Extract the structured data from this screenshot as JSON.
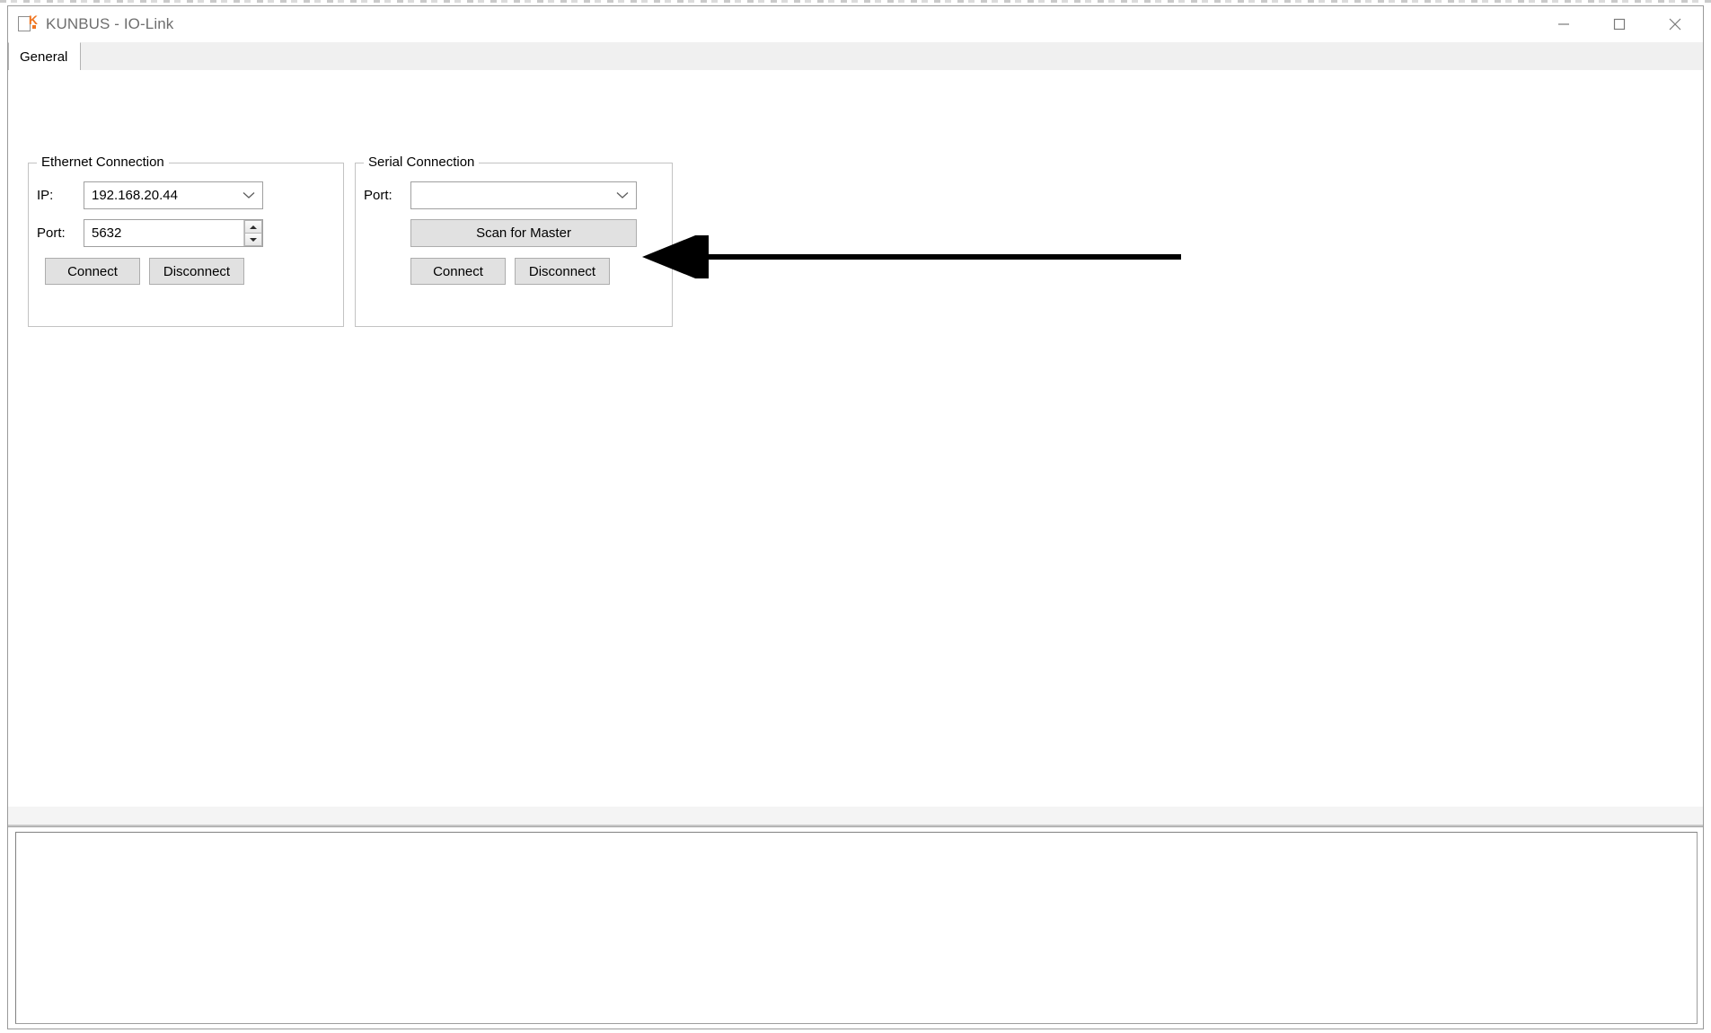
{
  "window": {
    "title": "KUNBUS - IO-Link",
    "icon": "kunbus-logo-icon",
    "controls": {
      "minimize": "minimize-icon",
      "maximize": "maximize-icon",
      "close": "close-icon"
    }
  },
  "tabs": [
    {
      "label": "General",
      "active": true
    }
  ],
  "ethernet_group": {
    "title": "Ethernet Connection",
    "ip": {
      "label": "IP:",
      "value": "192.168.20.44",
      "placeholder": ""
    },
    "port": {
      "label": "Port:",
      "value": "5632"
    },
    "connect_label": "Connect",
    "disconnect_label": "Disconnect"
  },
  "serial_group": {
    "title": "Serial Connection",
    "port": {
      "label": "Port:",
      "value": "",
      "placeholder": ""
    },
    "scan_label": "Scan for Master",
    "connect_label": "Connect",
    "disconnect_label": "Disconnect"
  },
  "annotation": {
    "type": "arrow-left",
    "target": "scan-for-master-button",
    "color": "#000000"
  },
  "log_panel": {
    "content": ""
  },
  "colors": {
    "accent_orange": "#ef7622",
    "button_face": "#e1e1e1",
    "tabstrip": "#f0f0f0",
    "window_border": "#9a9a9a"
  }
}
